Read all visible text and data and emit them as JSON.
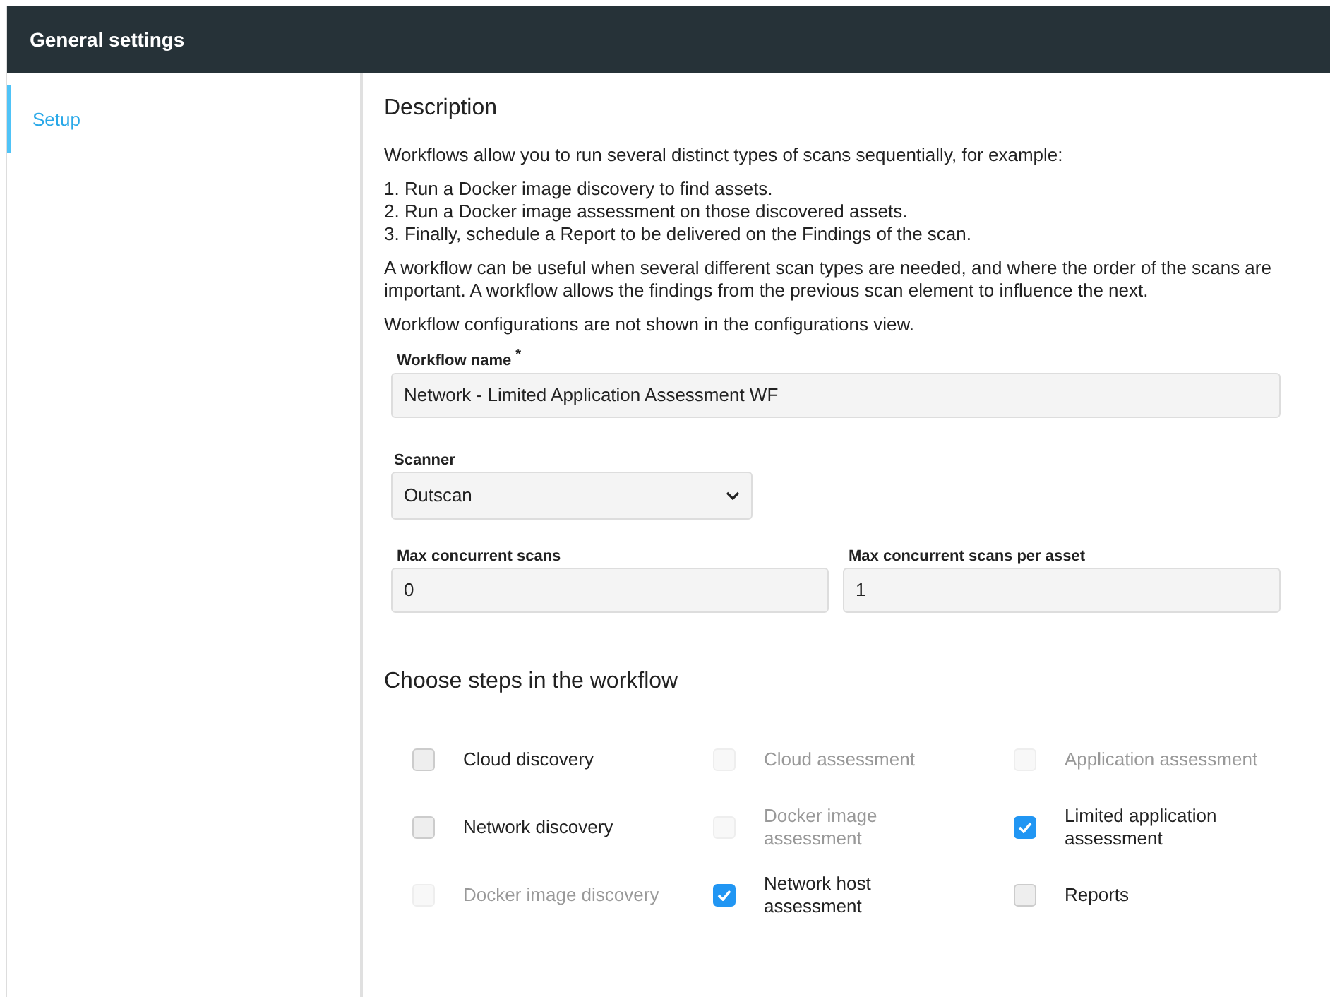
{
  "header": {
    "title": "General settings"
  },
  "sidebar": {
    "items": [
      {
        "label": "Setup",
        "selected": true
      }
    ]
  },
  "description": {
    "heading": "Description",
    "intro": "Workflows allow you to run several distinct types of scans sequentially, for example:",
    "steps": [
      "1. Run a Docker image discovery to find assets.",
      "2. Run a Docker image assessment on those discovered assets.",
      "3. Finally, schedule a Report to be delivered on the Findings of the scan."
    ],
    "paragraphs": [
      "A workflow can be useful when several different scan types are needed, and where the order of the scans are important. A workflow allows the findings from the previous scan element to influence the next.",
      "Workflow configurations are not shown in the configurations view."
    ]
  },
  "workflow_name": {
    "label": "Workflow name",
    "required_mark": "*",
    "value": "Network - Limited Application Assessment WF"
  },
  "scanner": {
    "label": "Scanner",
    "value": "Outscan"
  },
  "max_concurrent_scans": {
    "label": "Max concurrent scans",
    "value": "0"
  },
  "max_concurrent_scans_per_asset": {
    "label": "Max concurrent scans per asset",
    "value": "1"
  },
  "steps_section": {
    "heading": "Choose steps in the workflow",
    "options": [
      {
        "label": "Cloud discovery",
        "checked": false,
        "disabled": false
      },
      {
        "label": "Cloud assessment",
        "checked": false,
        "disabled": true
      },
      {
        "label": "Application assessment",
        "checked": false,
        "disabled": true
      },
      {
        "label": "Network discovery",
        "checked": false,
        "disabled": false
      },
      {
        "label": "Docker image assessment",
        "checked": false,
        "disabled": true
      },
      {
        "label": "Limited application assessment",
        "checked": true,
        "disabled": false
      },
      {
        "label": "Docker image discovery",
        "checked": false,
        "disabled": true
      },
      {
        "label": "Network host assessment",
        "checked": true,
        "disabled": false
      },
      {
        "label": "Reports",
        "checked": false,
        "disabled": false
      }
    ]
  }
}
